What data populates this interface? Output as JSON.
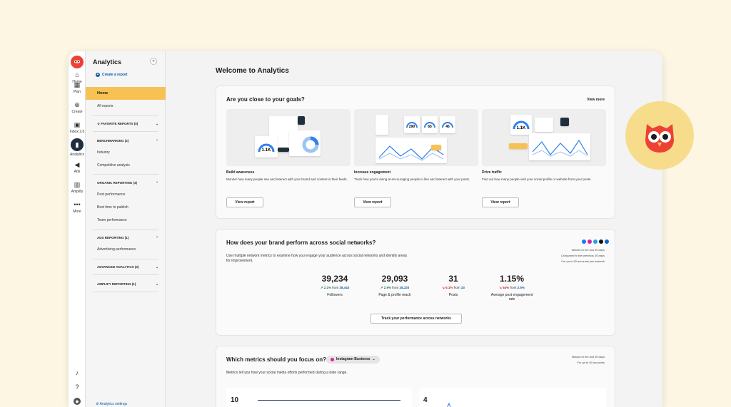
{
  "rail": {
    "items": [
      {
        "label": "Home",
        "icon": "home-icon"
      },
      {
        "label": "Plan",
        "icon": "calendar-icon"
      },
      {
        "label": "Create",
        "icon": "create-icon"
      },
      {
        "label": "Inbox 2.0",
        "icon": "inbox-icon"
      },
      {
        "label": "Analytics",
        "icon": "analytics-icon"
      },
      {
        "label": "Ads",
        "icon": "megaphone-icon"
      },
      {
        "label": "Amplify",
        "icon": "amplify-icon"
      },
      {
        "label": "More",
        "icon": "more-icon"
      }
    ]
  },
  "sidebar": {
    "title": "Analytics",
    "collapse": "«",
    "create_report": "Create a report",
    "home": "Home",
    "all_reports": "All reports",
    "favorite": "FAVORITE REPORTS (0)",
    "benchmarking": "BENCHMARKING (2)",
    "industry": "Industry",
    "competitive": "Competitive analysis",
    "organic": "ORGANIC REPORTING (3)",
    "post_performance": "Post performance",
    "best_time": "Best time to publish",
    "team_performance": "Team performance",
    "ads": "ADS REPORTING (1)",
    "advertising": "Advertising performance",
    "advanced": "ADVANCED ANALYTICS (3)",
    "amplify": "AMPLIFY REPORTING (1)",
    "settings": "Analytics settings"
  },
  "main": {
    "page_title": "Welcome to Analytics",
    "goals": {
      "title": "Are you close to your goals?",
      "view_more": "View more",
      "items": [
        {
          "title": "Build awareness",
          "desc": "Monitor how many people see and interact with your brand and content in their feeds.",
          "button": "View report",
          "metric": "1.1K"
        },
        {
          "title": "Increase engagement",
          "desc": "Track how you're doing at encouraging people to like and interact with your posts.",
          "button": "View report",
          "metrics": [
            "290",
            "65",
            "46"
          ]
        },
        {
          "title": "Drive traffic",
          "desc": "Find out how many people visit your social profile or website from your posts.",
          "button": "View report",
          "metric": "1.1K"
        }
      ]
    },
    "brand": {
      "title": "How does your brand perform across social networks?",
      "desc": "Use multiple network metrics to examine how you engage your audience across social networks and identify areas for improvement.",
      "note_1": "Based on the last 30 days",
      "note_2": "Compared to the previous 30 days",
      "note_3": "For up to 50 accounts per network",
      "stats": [
        {
          "value": "39,234",
          "change": "2.1%",
          "from": "from",
          "prev": "38,443",
          "label": "Followers",
          "dir": "up"
        },
        {
          "value": "29,093",
          "change": "2.9%",
          "from": "from",
          "prev": "28,220",
          "label": "Page & profile reach",
          "dir": "up"
        },
        {
          "value": "31",
          "change": "6.1%",
          "from": "from",
          "prev": "33",
          "label": "Posts",
          "dir": "down"
        },
        {
          "value": "1.15%",
          "change": "54%",
          "from": "from",
          "prev": "2.5%",
          "label": "Average post engagement rate",
          "dir": "down"
        }
      ],
      "button": "Track your performance across networks"
    },
    "metrics": {
      "title": "Which metrics should you focus on?",
      "dropdown": "Instagram Business",
      "desc": "Metrics tell you how your social media efforts performed during a date range.",
      "note_1": "Based on the last 30 days",
      "note_2": "For up to 50 accounts",
      "left_value": "10",
      "right_value": "4"
    }
  },
  "colors": {
    "accent": "#f7c154",
    "brand_red": "#ec4134",
    "link": "#0b5ca8",
    "up": "#1b7f3b",
    "down": "#c4262e"
  }
}
